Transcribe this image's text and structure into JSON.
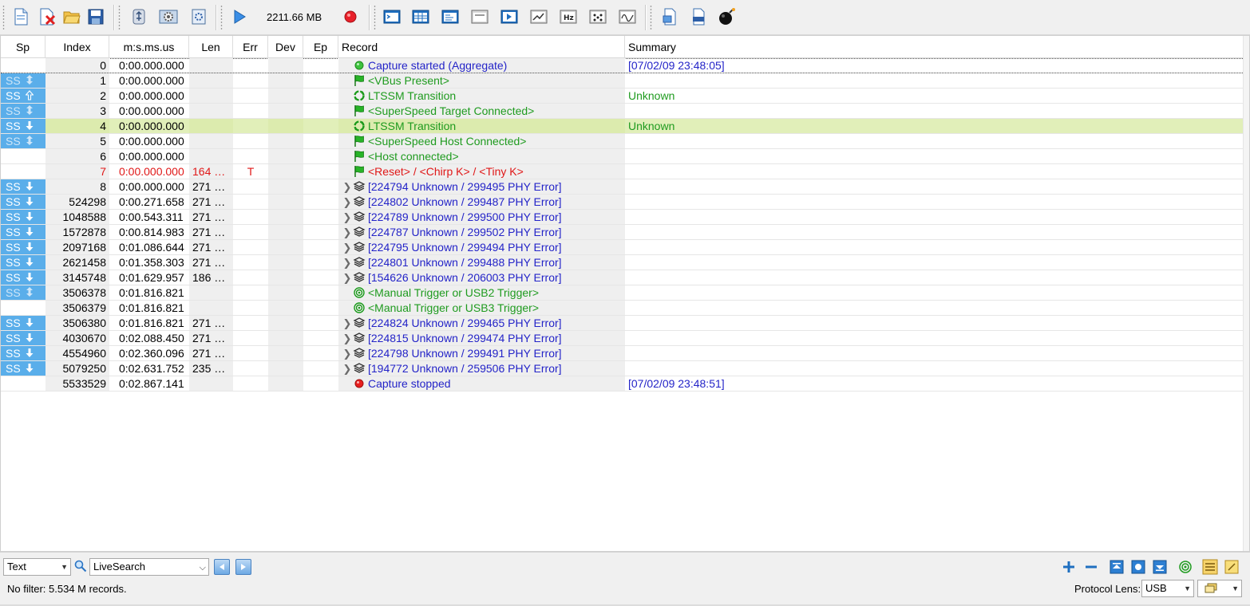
{
  "toolbar": {
    "capture_size": "2211.66 MB",
    "buttons": [
      "new-file",
      "close-file",
      "open-folder",
      "save",
      "device",
      "settings",
      "options",
      "start-capture",
      "stop-capture",
      "terminal-view",
      "table-view",
      "list-view",
      "window-view",
      "player",
      "graph-view",
      "hz",
      "pattern",
      "waveform",
      "export",
      "print",
      "bomb"
    ]
  },
  "columns": {
    "sp": "Sp",
    "index": "Index",
    "time": "m:s.ms.us",
    "len": "Len",
    "err": "Err",
    "dev": "Dev",
    "ep": "Ep",
    "record": "Record",
    "summary": "Summary"
  },
  "rows": [
    {
      "sp": "",
      "spstyle": "none",
      "arrow": "",
      "index": "0",
      "time": "0:00.000.000",
      "len": "",
      "err": "",
      "expand": false,
      "icon": "green-dot",
      "record": "Capture started (Aggregate)",
      "rcolor": "blue",
      "summary": "[07/02/09 23:48:05]",
      "scolor": "blue"
    },
    {
      "sp": "SS",
      "spstyle": "dim",
      "arrow": "both",
      "index": "1",
      "time": "0:00.000.000",
      "len": "",
      "err": "",
      "expand": false,
      "icon": "flag",
      "record": "<VBus Present>",
      "rcolor": "green",
      "summary": "",
      "scolor": ""
    },
    {
      "sp": "SS",
      "spstyle": "bright",
      "arrow": "up-outline",
      "index": "2",
      "time": "0:00.000.000",
      "len": "",
      "err": "",
      "expand": false,
      "icon": "recycle",
      "record": "LTSSM Transition",
      "rcolor": "green",
      "summary": "Unknown",
      "scolor": "green"
    },
    {
      "sp": "SS",
      "spstyle": "dim",
      "arrow": "both",
      "index": "3",
      "time": "0:00.000.000",
      "len": "",
      "err": "",
      "expand": false,
      "icon": "flag",
      "record": "<SuperSpeed Target Connected>",
      "rcolor": "green",
      "summary": "",
      "scolor": ""
    },
    {
      "sp": "SS",
      "spstyle": "bright",
      "arrow": "down",
      "index": "4",
      "time": "0:00.000.000",
      "len": "",
      "err": "",
      "expand": false,
      "icon": "recycle",
      "record": "LTSSM Transition",
      "rcolor": "green",
      "summary": "Unknown",
      "scolor": "green"
    },
    {
      "sp": "SS",
      "spstyle": "dim",
      "arrow": "both",
      "index": "5",
      "time": "0:00.000.000",
      "len": "",
      "err": "",
      "expand": false,
      "icon": "flag",
      "record": "<SuperSpeed Host Connected>",
      "rcolor": "green",
      "summary": "",
      "scolor": ""
    },
    {
      "sp": "",
      "spstyle": "none",
      "arrow": "",
      "index": "6",
      "time": "0:00.000.000",
      "len": "",
      "err": "",
      "expand": false,
      "icon": "flag",
      "record": "<Host connected>",
      "rcolor": "green",
      "summary": "",
      "scolor": ""
    },
    {
      "sp": "",
      "spstyle": "none",
      "arrow": "",
      "index": "7",
      "time": "0:00.000.000",
      "len": "164 …",
      "err": "T",
      "expand": false,
      "icon": "flag",
      "record": "<Reset> / <Chirp K> / <Tiny K>",
      "rcolor": "red",
      "summary": "",
      "scolor": "",
      "red": true
    },
    {
      "sp": "SS",
      "spstyle": "bright",
      "arrow": "down",
      "index": "8",
      "time": "0:00.000.000",
      "len": "271 …",
      "err": "",
      "expand": true,
      "icon": "stack",
      "record": "[224794 Unknown / 299495 PHY Error]",
      "rcolor": "blue",
      "summary": "",
      "scolor": ""
    },
    {
      "sp": "SS",
      "spstyle": "bright",
      "arrow": "down",
      "index": "524298",
      "time": "0:00.271.658",
      "len": "271 …",
      "err": "",
      "expand": true,
      "icon": "stack",
      "record": "[224802 Unknown / 299487 PHY Error]",
      "rcolor": "blue",
      "summary": "",
      "scolor": ""
    },
    {
      "sp": "SS",
      "spstyle": "bright",
      "arrow": "down",
      "index": "1048588",
      "time": "0:00.543.311",
      "len": "271 …",
      "err": "",
      "expand": true,
      "icon": "stack",
      "record": "[224789 Unknown / 299500 PHY Error]",
      "rcolor": "blue",
      "summary": "",
      "scolor": ""
    },
    {
      "sp": "SS",
      "spstyle": "bright",
      "arrow": "down",
      "index": "1572878",
      "time": "0:00.814.983",
      "len": "271 …",
      "err": "",
      "expand": true,
      "icon": "stack",
      "record": "[224787 Unknown / 299502 PHY Error]",
      "rcolor": "blue",
      "summary": "",
      "scolor": ""
    },
    {
      "sp": "SS",
      "spstyle": "bright",
      "arrow": "down",
      "index": "2097168",
      "time": "0:01.086.644",
      "len": "271 …",
      "err": "",
      "expand": true,
      "icon": "stack",
      "record": "[224795 Unknown / 299494 PHY Error]",
      "rcolor": "blue",
      "summary": "",
      "scolor": ""
    },
    {
      "sp": "SS",
      "spstyle": "bright",
      "arrow": "down",
      "index": "2621458",
      "time": "0:01.358.303",
      "len": "271 …",
      "err": "",
      "expand": true,
      "icon": "stack",
      "record": "[224801 Unknown / 299488 PHY Error]",
      "rcolor": "blue",
      "summary": "",
      "scolor": ""
    },
    {
      "sp": "SS",
      "spstyle": "bright",
      "arrow": "down",
      "index": "3145748",
      "time": "0:01.629.957",
      "len": "186 …",
      "err": "",
      "expand": true,
      "icon": "stack",
      "record": "[154626 Unknown / 206003 PHY Error]",
      "rcolor": "blue",
      "summary": "",
      "scolor": ""
    },
    {
      "sp": "SS",
      "spstyle": "dim",
      "arrow": "both",
      "index": "3506378",
      "time": "0:01.816.821",
      "len": "",
      "err": "",
      "expand": false,
      "icon": "target",
      "record": "<Manual Trigger or USB2 Trigger>",
      "rcolor": "green",
      "summary": "",
      "scolor": ""
    },
    {
      "sp": "",
      "spstyle": "none",
      "arrow": "",
      "index": "3506379",
      "time": "0:01.816.821",
      "len": "",
      "err": "",
      "expand": false,
      "icon": "target",
      "record": "<Manual Trigger or USB3 Trigger>",
      "rcolor": "green",
      "summary": "",
      "scolor": ""
    },
    {
      "sp": "SS",
      "spstyle": "bright",
      "arrow": "down",
      "index": "3506380",
      "time": "0:01.816.821",
      "len": "271 …",
      "err": "",
      "expand": true,
      "icon": "stack",
      "record": "[224824 Unknown / 299465 PHY Error]",
      "rcolor": "blue",
      "summary": "",
      "scolor": ""
    },
    {
      "sp": "SS",
      "spstyle": "bright",
      "arrow": "down",
      "index": "4030670",
      "time": "0:02.088.450",
      "len": "271 …",
      "err": "",
      "expand": true,
      "icon": "stack",
      "record": "[224815 Unknown / 299474 PHY Error]",
      "rcolor": "blue",
      "summary": "",
      "scolor": ""
    },
    {
      "sp": "SS",
      "spstyle": "bright",
      "arrow": "down",
      "index": "4554960",
      "time": "0:02.360.096",
      "len": "271 …",
      "err": "",
      "expand": true,
      "icon": "stack",
      "record": "[224798 Unknown / 299491 PHY Error]",
      "rcolor": "blue",
      "summary": "",
      "scolor": ""
    },
    {
      "sp": "SS",
      "spstyle": "bright",
      "arrow": "down",
      "index": "5079250",
      "time": "0:02.631.752",
      "len": "235 …",
      "err": "",
      "expand": true,
      "icon": "stack",
      "record": "[194772 Unknown / 259506 PHY Error]",
      "rcolor": "blue",
      "summary": "",
      "scolor": ""
    },
    {
      "sp": "",
      "spstyle": "none",
      "arrow": "",
      "index": "5533529",
      "time": "0:02.867.141",
      "len": "",
      "err": "",
      "expand": false,
      "icon": "red-dot",
      "record": "Capture stopped",
      "rcolor": "blue",
      "summary": "[07/02/09 23:48:51]",
      "scolor": "blue"
    }
  ],
  "selected_row": 4,
  "focused_row": 0,
  "bottom": {
    "view_mode": "Text",
    "search_mode": "LiveSearch",
    "status": "No filter: 5.534 M records.",
    "protocol_lens_label": "Protocol Lens:",
    "protocol_lens_value": "USB"
  },
  "colors": {
    "sp_highlight": "#5aaeea",
    "selected_row": "#e1efb9",
    "record_blue": "#2424c8",
    "record_green": "#1f9b1f",
    "record_red": "#e01818"
  }
}
